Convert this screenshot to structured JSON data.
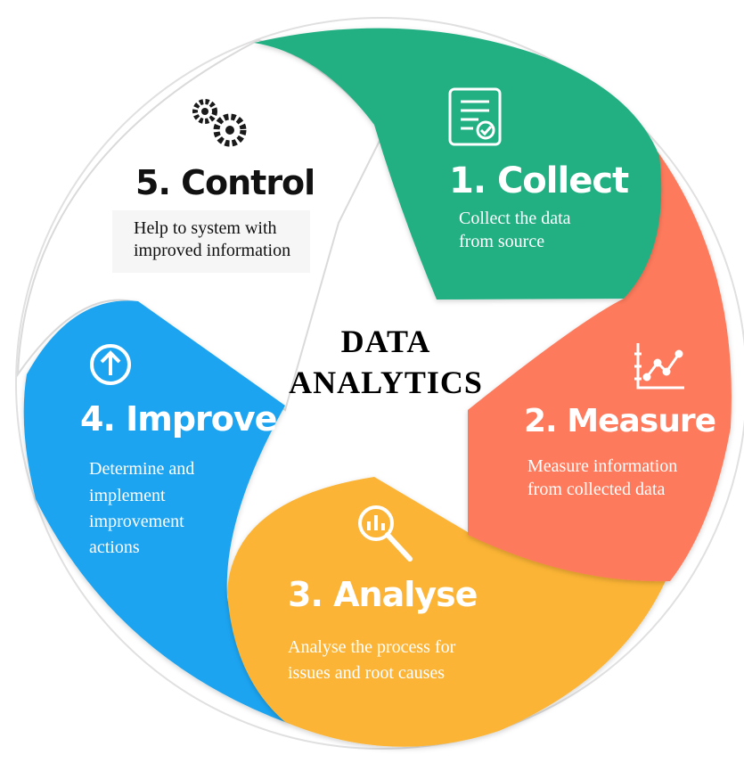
{
  "diagram": {
    "center_title_line1": "DATA",
    "center_title_line2": "ANALYTICS",
    "colors": {
      "collect": "#22b083",
      "measure": "#fe7a5b",
      "analyse": "#fbb436",
      "improve": "#1aa4f1",
      "control": "#ffffff",
      "outline": "#dcdcdc"
    },
    "steps": [
      {
        "id": "collect",
        "title": "1. Collect",
        "desc_line1": "Collect the data",
        "desc_line2": "from source",
        "icon": "checklist-document-icon"
      },
      {
        "id": "measure",
        "title": "2. Measure",
        "desc_line1": "Measure information",
        "desc_line2": "from collected data",
        "icon": "line-chart-icon"
      },
      {
        "id": "analyse",
        "title": "3. Analyse",
        "desc_line1": "Analyse the process for",
        "desc_line2": "issues and root causes",
        "icon": "magnifier-chart-icon"
      },
      {
        "id": "improve",
        "title": "4. Improve",
        "desc_line1": "Determine and",
        "desc_line2": "implement",
        "desc_line3": "improvement",
        "desc_line4": "actions",
        "icon": "arrow-up-circle-icon"
      },
      {
        "id": "control",
        "title": "5. Control",
        "desc_line1": "Help to system with",
        "desc_line2": "improved information",
        "icon": "gears-icon"
      }
    ]
  }
}
